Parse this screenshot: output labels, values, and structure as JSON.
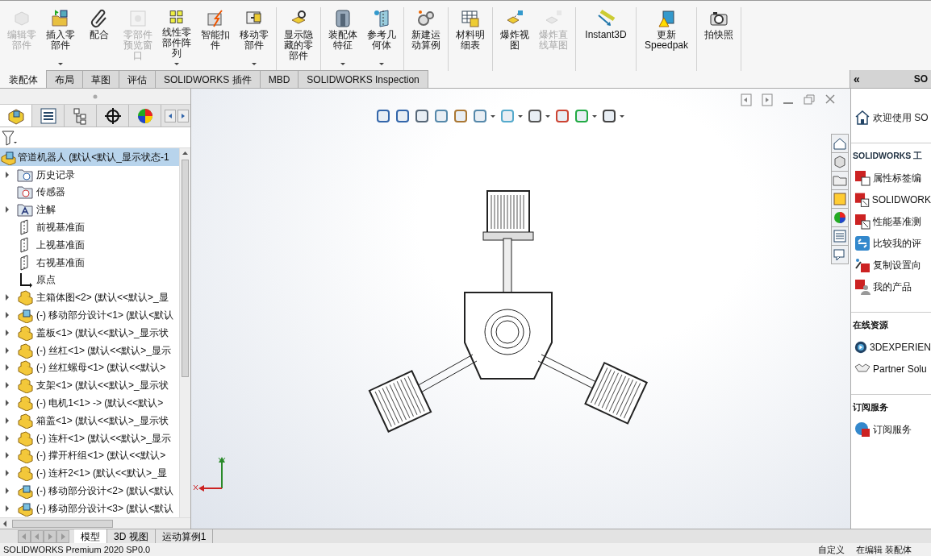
{
  "ribbon": {
    "groups": [
      {
        "buttons": [
          {
            "label": "编辑零部件",
            "disabled": true,
            "dropdown": false
          },
          {
            "label": "插入零部件",
            "disabled": false,
            "dropdown": true
          },
          {
            "label": "配合",
            "disabled": false,
            "dropdown": false
          },
          {
            "label": "零部件预览窗口",
            "disabled": true,
            "dropdown": false
          },
          {
            "label": "线性零部件阵列",
            "disabled": false,
            "dropdown": true
          },
          {
            "label": "智能扣件",
            "disabled": false,
            "dropdown": false
          },
          {
            "label": "移动零部件",
            "disabled": false,
            "dropdown": true
          }
        ]
      },
      {
        "buttons": [
          {
            "label": "显示隐藏的零部件",
            "disabled": false,
            "dropdown": false
          }
        ]
      },
      {
        "buttons": [
          {
            "label": "装配体特征",
            "disabled": false,
            "dropdown": true
          },
          {
            "label": "参考几何体",
            "disabled": false,
            "dropdown": true
          }
        ]
      },
      {
        "buttons": [
          {
            "label": "新建运动算例",
            "disabled": false,
            "dropdown": false
          }
        ]
      },
      {
        "buttons": [
          {
            "label": "材料明细表",
            "disabled": false,
            "dropdown": false
          }
        ]
      },
      {
        "buttons": [
          {
            "label": "爆炸视图",
            "disabled": false,
            "dropdown": false
          },
          {
            "label": "爆炸直线草图",
            "disabled": true,
            "dropdown": false
          }
        ]
      },
      {
        "buttons": [
          {
            "label": "Instant3D",
            "disabled": false,
            "dropdown": false
          }
        ]
      },
      {
        "buttons": [
          {
            "label": "更新 Speedpak",
            "disabled": false,
            "dropdown": false
          }
        ]
      },
      {
        "buttons": [
          {
            "label": "拍快照",
            "disabled": false,
            "dropdown": false
          }
        ]
      }
    ]
  },
  "tabs": [
    {
      "label": "装配体",
      "selected": true
    },
    {
      "label": "布局",
      "selected": false
    },
    {
      "label": "草图",
      "selected": false
    },
    {
      "label": "评估",
      "selected": false
    },
    {
      "label": "SOLIDWORKS 插件",
      "selected": false
    },
    {
      "label": "MBD",
      "selected": false
    },
    {
      "label": "SOLIDWORKS Inspection",
      "selected": false
    }
  ],
  "tree": {
    "root": {
      "label": "管道机器人  (默认<默认_显示状态-1",
      "children": [
        {
          "kind": "history",
          "label": "历史记录",
          "expandable": true
        },
        {
          "kind": "sensor",
          "label": "传感器",
          "expandable": false
        },
        {
          "kind": "annotation",
          "label": "注解",
          "expandable": true
        },
        {
          "kind": "plane",
          "label": "前视基准面",
          "expandable": false
        },
        {
          "kind": "plane",
          "label": "上视基准面",
          "expandable": false
        },
        {
          "kind": "plane",
          "label": "右视基准面",
          "expandable": false
        },
        {
          "kind": "origin",
          "label": "原点",
          "expandable": false
        },
        {
          "kind": "part",
          "label": "主箱体图<2> (默认<<默认>_显",
          "expandable": true
        },
        {
          "kind": "assembly",
          "label": "(-) 移动部分设计<1> (默认<默认",
          "expandable": true
        },
        {
          "kind": "part",
          "label": "盖板<1> (默认<<默认>_显示状",
          "expandable": true
        },
        {
          "kind": "part",
          "label": "(-) 丝杠<1> (默认<<默认>_显示",
          "expandable": true
        },
        {
          "kind": "part",
          "label": "(-) 丝杠螺母<1> (默认<<默认>",
          "expandable": true
        },
        {
          "kind": "part",
          "label": "支架<1> (默认<<默认>_显示状",
          "expandable": true
        },
        {
          "kind": "part",
          "label": "(-) 电机1<1> -> (默认<<默认>",
          "expandable": true
        },
        {
          "kind": "part",
          "label": "箱盖<1> (默认<<默认>_显示状",
          "expandable": true
        },
        {
          "kind": "part",
          "label": "(-) 连杆<1> (默认<<默认>_显示",
          "expandable": true
        },
        {
          "kind": "part",
          "label": "(-) 撑开杆组<1> (默认<<默认>",
          "expandable": true
        },
        {
          "kind": "part",
          "label": "(-) 连杆2<1> (默认<<默认>_显",
          "expandable": true
        },
        {
          "kind": "assembly",
          "label": "(-) 移动部分设计<2> (默认<默认",
          "expandable": true
        },
        {
          "kind": "assembly",
          "label": "(-) 移动部分设计<3> (默认<默认",
          "expandable": true
        }
      ]
    }
  },
  "bottom_tabs": [
    {
      "label": "模型",
      "selected": true
    },
    {
      "label": "3D 视图",
      "selected": false
    },
    {
      "label": "运动算例1",
      "selected": false
    }
  ],
  "task_pane": {
    "collapse": "«",
    "title": "SO",
    "welcome": {
      "kind": "home",
      "label": "欢迎使用  SO"
    },
    "sections": [
      {
        "title": "SOLIDWORKS 工",
        "items": [
          {
            "kind": "sw-doc",
            "label": "属性标签编"
          },
          {
            "kind": "sw-rx",
            "label": "SOLIDWORK"
          },
          {
            "kind": "sw-rx",
            "label": "性能基准测"
          },
          {
            "kind": "compare",
            "label": "比较我的评"
          },
          {
            "kind": "copy",
            "label": "复制设置向"
          },
          {
            "kind": "products",
            "label": "我的产品"
          }
        ]
      },
      {
        "title": "在线资源",
        "items": [
          {
            "kind": "player",
            "label": "3DEXPERIEN"
          },
          {
            "kind": "partner",
            "label": "Partner Solu"
          }
        ]
      },
      {
        "title": "订阅服务",
        "items": [
          {
            "kind": "subscribe",
            "label": "订阅服务"
          }
        ]
      }
    ]
  },
  "status_bar": {
    "left": "SOLIDWORKS Premium 2020 SP0.0",
    "right": [
      "自定义",
      "在编辑 装配体"
    ]
  }
}
